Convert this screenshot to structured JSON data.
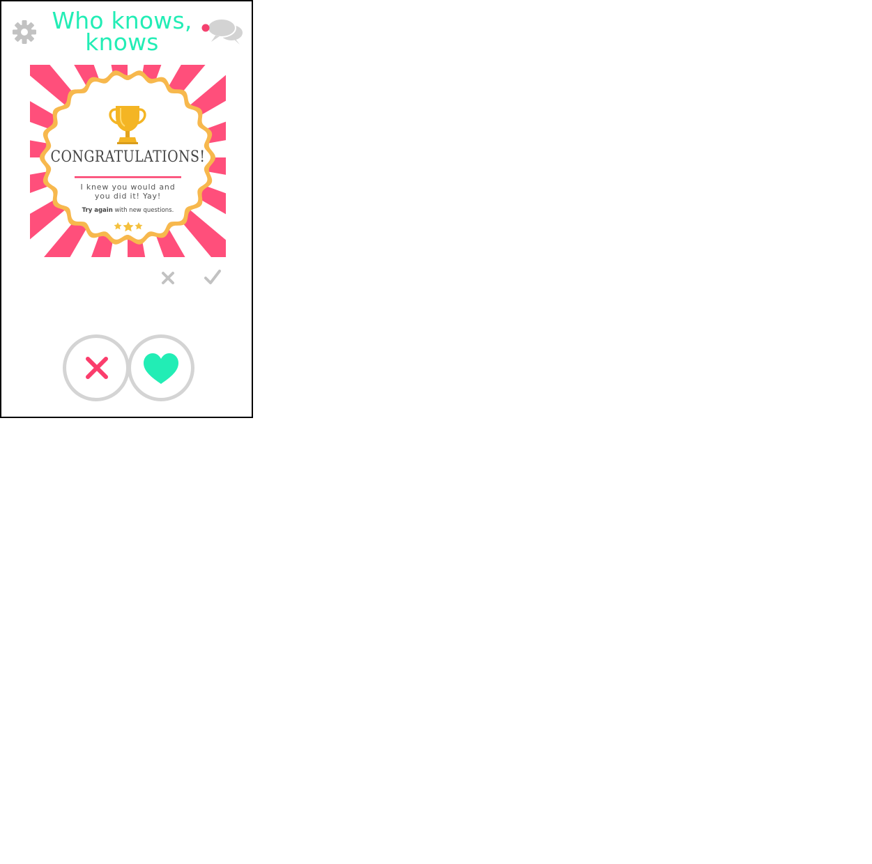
{
  "app": {
    "title_line1": "Who knows,",
    "title_line2": "knows"
  },
  "card": {
    "heading": "CONGRATULATIONS!",
    "message": "I knew you would and you did it! Yay!",
    "try_bold": "Try again",
    "try_rest": " with new questions."
  },
  "colors": {
    "accent_teal": "#22edb5",
    "accent_pink": "#fb3d6c",
    "ray_pink": "#ff4f7b",
    "badge_border": "#f7b84d",
    "trophy_gold": "#f4b524",
    "icon_gray": "#c2c2c2",
    "notification_dot": "#f4416f"
  },
  "icons": {
    "settings": "gear-icon",
    "chat": "chat-bubbles-icon",
    "dismiss_small": "close-icon",
    "accept_small": "check-icon",
    "nope": "cross-icon",
    "like": "heart-icon",
    "trophy": "trophy-icon"
  }
}
